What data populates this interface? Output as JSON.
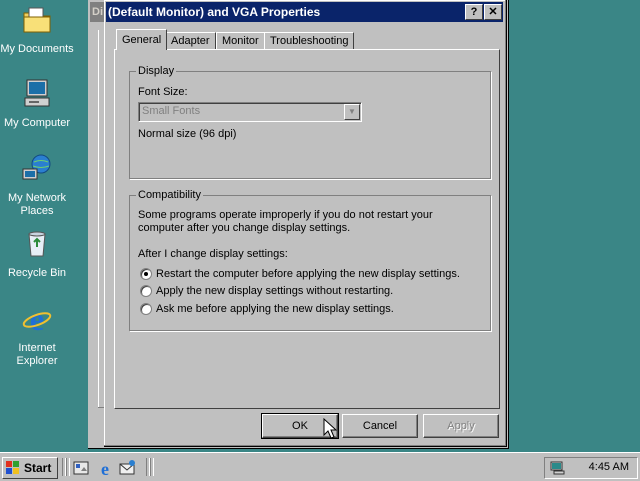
{
  "desktop": {
    "icons": [
      {
        "label": "My Documents",
        "icon": "folder-documents-icon"
      },
      {
        "label": "My Computer",
        "icon": "computer-icon"
      },
      {
        "label": "My Network Places",
        "icon": "network-places-icon"
      },
      {
        "label": "Recycle Bin",
        "icon": "recycle-bin-icon"
      },
      {
        "label": "Internet Explorer",
        "icon": "internet-explorer-icon"
      }
    ]
  },
  "background_window": {
    "title_fragment": "Di"
  },
  "dialog": {
    "title": "(Default Monitor) and VGA Properties",
    "help_button": "?",
    "close_button": "✕",
    "tabs": [
      "General",
      "Adapter",
      "Monitor",
      "Troubleshooting"
    ],
    "active_tab": "General",
    "display_group": {
      "legend": "Display",
      "font_size_label": "Font Size:",
      "font_size_value": "Small Fonts",
      "dpi_text": "Normal size (96 dpi)"
    },
    "compat_group": {
      "legend": "Compatibility",
      "description_line1": "Some programs operate improperly if you do not restart your",
      "description_line2": "computer after you change display settings.",
      "after_label": "After I change display settings:",
      "options": [
        {
          "label": "Restart the computer before applying the new display settings.",
          "selected": true
        },
        {
          "label": "Apply the new display settings without restarting.",
          "selected": false
        },
        {
          "label": "Ask me before applying the new display settings.",
          "selected": false
        }
      ]
    },
    "buttons": {
      "ok": "OK",
      "cancel": "Cancel",
      "apply": "Apply"
    }
  },
  "taskbar": {
    "start_label": "Start",
    "quick_launch": [
      "show-desktop-icon",
      "internet-explorer-icon",
      "outlook-express-icon"
    ],
    "tray": {
      "icon": "display-settings-icon",
      "clock": "4:45 AM"
    }
  },
  "colors": {
    "desktop": "#3a8686",
    "title_active": "#0a246a",
    "face": "#c0c0c0"
  }
}
